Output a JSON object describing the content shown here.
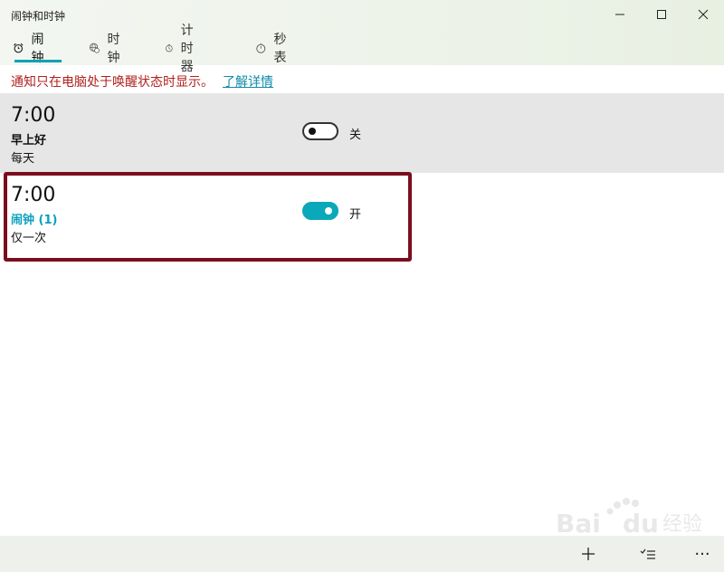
{
  "window": {
    "title": "闹钟和时钟"
  },
  "tabs": [
    {
      "label": "闹钟",
      "icon": "alarm-clock-icon",
      "selected": true
    },
    {
      "label": "时钟",
      "icon": "world-clock-icon",
      "selected": false
    },
    {
      "label": "计时器",
      "icon": "timer-icon",
      "selected": false
    },
    {
      "label": "秒表",
      "icon": "stopwatch-icon",
      "selected": false
    }
  ],
  "notice": {
    "text": "通知只在电脑处于唤醒状态时显示。",
    "link": "了解详情"
  },
  "alarms": [
    {
      "time": "7:00",
      "name": "早上好",
      "repeat": "每天",
      "state_label": "关",
      "on": false
    },
    {
      "time": "7:00",
      "name": "闹钟 (1)",
      "repeat": "仅一次",
      "state_label": "开",
      "on": true
    }
  ],
  "commands": {
    "add_icon": "plus-icon",
    "select_icon": "select-list-icon",
    "more": "···"
  },
  "colors": {
    "accent": "#00a3b4",
    "notice_text": "#b0221e",
    "highlight_border": "#7a0e1e",
    "selected_alarm_bg": "#e6e6e6"
  }
}
